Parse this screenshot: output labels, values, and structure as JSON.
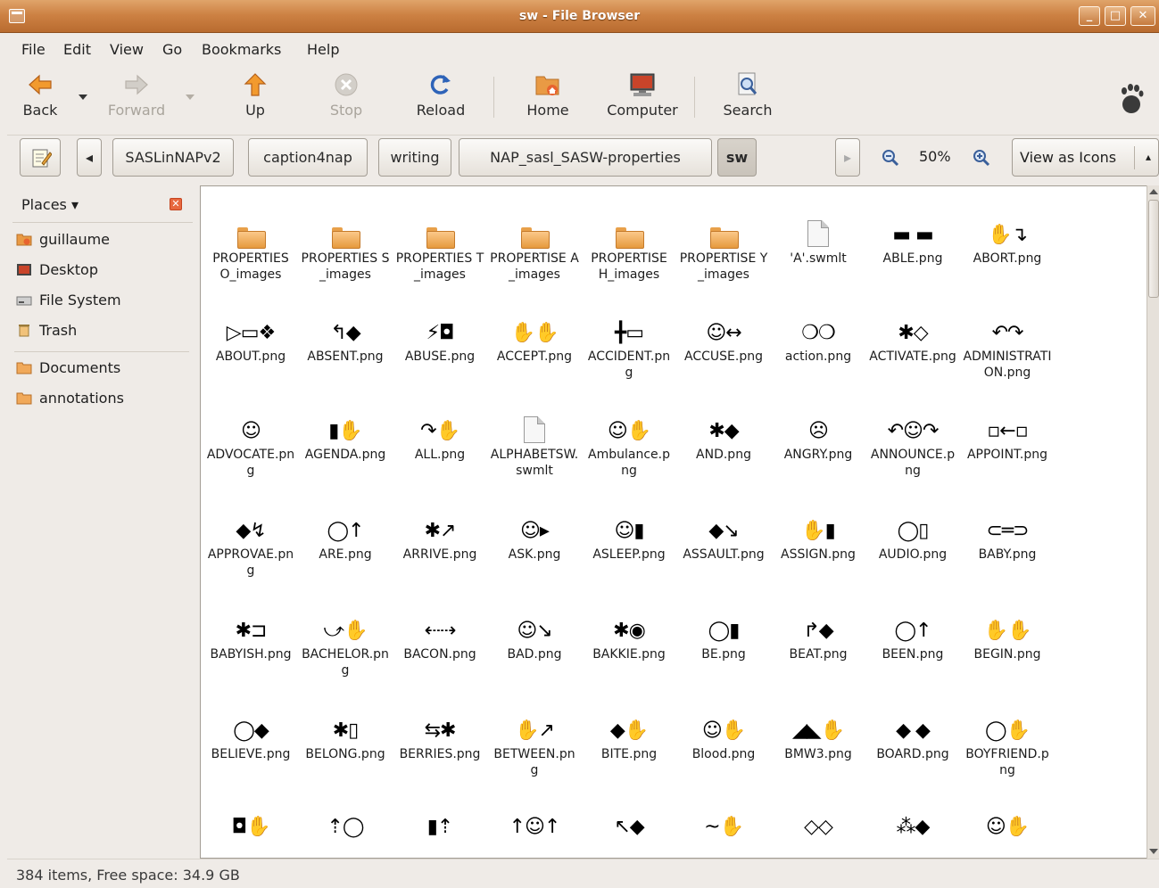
{
  "window": {
    "title": "sw - File Browser",
    "buttons": [
      "minimize",
      "maximize",
      "close"
    ]
  },
  "menubar": {
    "items": [
      "File",
      "Edit",
      "View",
      "Go",
      "Bookmarks",
      "Help"
    ]
  },
  "toolbar": {
    "back": "Back",
    "forward": "Forward",
    "up": "Up",
    "stop": "Stop",
    "reload": "Reload",
    "home": "Home",
    "computer": "Computer",
    "search": "Search"
  },
  "location": {
    "crumbs": [
      "SASLinNAPv2",
      "caption4nap",
      "writing",
      "NAP_sasl_SASW-properties",
      "sw"
    ],
    "zoom": "50%",
    "view_mode": "View as Icons"
  },
  "sidebar": {
    "header": "Places",
    "places": [
      "guillaume",
      "Desktop",
      "File System",
      "Trash"
    ],
    "bookmarks": [
      "Documents",
      "annotations"
    ]
  },
  "items": [
    {
      "name": "PROPERTIES O_images",
      "kind": "folder",
      "glyph": ""
    },
    {
      "name": "PROPERTIES S_images",
      "kind": "folder",
      "glyph": ""
    },
    {
      "name": "PROPERTIES T_images",
      "kind": "folder",
      "glyph": ""
    },
    {
      "name": "PROPERTISE A_images",
      "kind": "folder",
      "glyph": ""
    },
    {
      "name": "PROPERTISE H_images",
      "kind": "folder",
      "glyph": ""
    },
    {
      "name": "PROPERTISE Y_images",
      "kind": "folder",
      "glyph": ""
    },
    {
      "name": "'A'.swmlt",
      "kind": "doc",
      "glyph": ""
    },
    {
      "name": "ABLE.png",
      "kind": "sign",
      "glyph": "▬ ▬"
    },
    {
      "name": "ABORT.png",
      "kind": "sign",
      "glyph": "✋↴"
    },
    {
      "name": "ABOUT.png",
      "kind": "sign",
      "glyph": "▷▭❖"
    },
    {
      "name": "ABSENT.png",
      "kind": "sign",
      "glyph": "↰◆"
    },
    {
      "name": "ABUSE.png",
      "kind": "sign",
      "glyph": "⚡◘"
    },
    {
      "name": "ACCEPT.png",
      "kind": "sign",
      "glyph": "✋✋"
    },
    {
      "name": "ACCIDENT.png",
      "kind": "sign",
      "glyph": "╋▭"
    },
    {
      "name": "ACCUSE.png",
      "kind": "sign",
      "glyph": "☺↔"
    },
    {
      "name": "action.png",
      "kind": "sign",
      "glyph": "❍❍"
    },
    {
      "name": "ACTIVATE.png",
      "kind": "sign",
      "glyph": "✱◇"
    },
    {
      "name": "ADMINISTRATION.png",
      "kind": "sign",
      "glyph": "↶↷"
    },
    {
      "name": "ADVOCATE.png",
      "kind": "sign",
      "glyph": "☺"
    },
    {
      "name": "AGENDA.png",
      "kind": "sign",
      "glyph": "▮✋"
    },
    {
      "name": "ALL.png",
      "kind": "sign",
      "glyph": "↷✋"
    },
    {
      "name": "ALPHABETSW.swmlt",
      "kind": "doc",
      "glyph": ""
    },
    {
      "name": "Ambulance.png",
      "kind": "sign",
      "glyph": "☺✋"
    },
    {
      "name": "AND.png",
      "kind": "sign",
      "glyph": "✱◆"
    },
    {
      "name": "ANGRY.png",
      "kind": "sign",
      "glyph": "☹"
    },
    {
      "name": "ANNOUNCE.png",
      "kind": "sign",
      "glyph": "↶☺↷"
    },
    {
      "name": "APPOINT.png",
      "kind": "sign",
      "glyph": "▫←▫"
    },
    {
      "name": "APPROVAE.png",
      "kind": "sign",
      "glyph": "◆↯"
    },
    {
      "name": "ARE.png",
      "kind": "sign",
      "glyph": "◯↑"
    },
    {
      "name": "ARRIVE.png",
      "kind": "sign",
      "glyph": "✱↗"
    },
    {
      "name": "ASK.png",
      "kind": "sign",
      "glyph": "☺▸"
    },
    {
      "name": "ASLEEP.png",
      "kind": "sign",
      "glyph": "☺▮"
    },
    {
      "name": "ASSAULT.png",
      "kind": "sign",
      "glyph": "◆↘"
    },
    {
      "name": "ASSIGN.png",
      "kind": "sign",
      "glyph": "✋▮"
    },
    {
      "name": "AUDIO.png",
      "kind": "sign",
      "glyph": "◯▯"
    },
    {
      "name": "BABY.png",
      "kind": "sign",
      "glyph": "⊂═⊃"
    },
    {
      "name": "BABYISH.png",
      "kind": "sign",
      "glyph": "✱⊐"
    },
    {
      "name": "BACHELOR.png",
      "kind": "sign",
      "glyph": "⤻✋"
    },
    {
      "name": "BACON.png",
      "kind": "sign",
      "glyph": "⇠⇢"
    },
    {
      "name": "BAD.png",
      "kind": "sign",
      "glyph": "☺↘"
    },
    {
      "name": "BAKKIE.png",
      "kind": "sign",
      "glyph": "✱◉"
    },
    {
      "name": "BE.png",
      "kind": "sign",
      "glyph": "◯▮"
    },
    {
      "name": "BEAT.png",
      "kind": "sign",
      "glyph": "↱◆"
    },
    {
      "name": "BEEN.png",
      "kind": "sign",
      "glyph": "◯↑"
    },
    {
      "name": "BEGIN.png",
      "kind": "sign",
      "glyph": "✋✋"
    },
    {
      "name": "BELIEVE.png",
      "kind": "sign",
      "glyph": "◯◆"
    },
    {
      "name": "BELONG.png",
      "kind": "sign",
      "glyph": "✱▯"
    },
    {
      "name": "BERRIES.png",
      "kind": "sign",
      "glyph": "⇆✱"
    },
    {
      "name": "BETWEEN.png",
      "kind": "sign",
      "glyph": "✋↗"
    },
    {
      "name": "BITE.png",
      "kind": "sign",
      "glyph": "◆✋"
    },
    {
      "name": "Blood.png",
      "kind": "sign",
      "glyph": "☺✋"
    },
    {
      "name": "BMW3.png",
      "kind": "sign",
      "glyph": "◢◣✋"
    },
    {
      "name": "BOARD.png",
      "kind": "sign",
      "glyph": "◆ ◆"
    },
    {
      "name": "BOYFRIEND.png",
      "kind": "sign",
      "glyph": "◯✋"
    },
    {
      "name": "",
      "kind": "sign",
      "glyph": "◘✋"
    },
    {
      "name": "",
      "kind": "sign",
      "glyph": "⇡◯"
    },
    {
      "name": "",
      "kind": "sign",
      "glyph": "▮⇡"
    },
    {
      "name": "",
      "kind": "sign",
      "glyph": "↑☺↑"
    },
    {
      "name": "",
      "kind": "sign",
      "glyph": "↖◆"
    },
    {
      "name": "",
      "kind": "sign",
      "glyph": "~✋"
    },
    {
      "name": "",
      "kind": "sign",
      "glyph": "◇◇"
    },
    {
      "name": "",
      "kind": "sign",
      "glyph": "⁂◆"
    },
    {
      "name": "",
      "kind": "sign",
      "glyph": "☺✋"
    }
  ],
  "status": {
    "text": "384 items, Free space: 34.9 GB"
  }
}
